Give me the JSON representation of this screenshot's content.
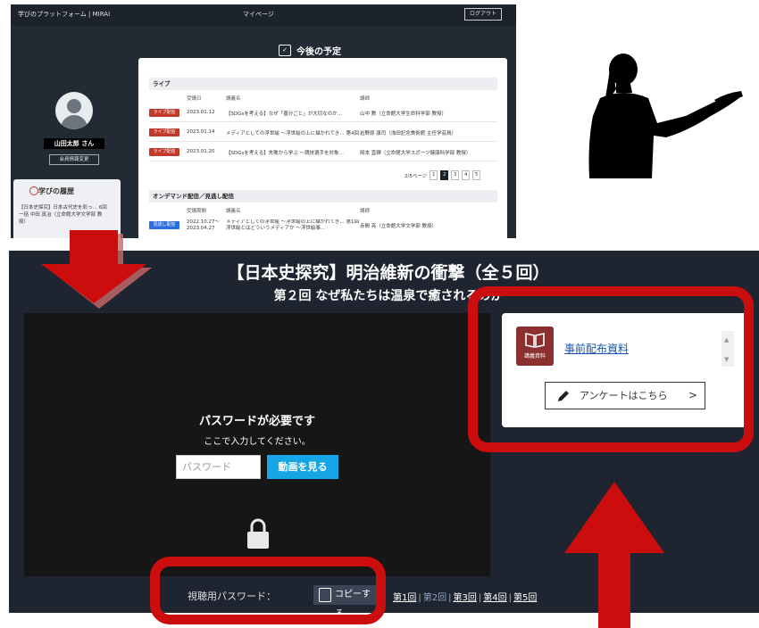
{
  "top_screenshot": {
    "brand": "学びのプラットフォーム | MIRAI",
    "page_title": "マイページ",
    "logout_label": "ログアウト",
    "schedule_heading": "今後の予定",
    "user_name": "山田太郎 さん",
    "profile_button": "会員情報変更",
    "history_heading": "学びの履歴",
    "history_item": "【日本史探究】日本古代史を彩っ… 6回一括 中田 真冶（立命館大学文学部 教授）",
    "live": {
      "section": "ライブ",
      "columns": [
        "受講日",
        "講義名",
        "講師"
      ],
      "rows": [
        {
          "tag": "ライブ配信",
          "date": "2023.01.12",
          "title": "【SDGsを考える】なぜ「善分ごと」が大切なのか…",
          "lecturer": "山中 教（立命館大学生命科学部 教授）"
        },
        {
          "tag": "ライブ配信",
          "date": "2023.01.14",
          "title": "メディアとしての浮世絵 ～浮世絵の上に描かれてき… 第4回 浮世絵は戦争をどう描いたか",
          "lecturer": "岩野原 康司（浅田記念美術館 主任学芸員）"
        },
        {
          "tag": "ライブ配信",
          "date": "2023.01.20",
          "title": "【SDGsを考える】失敗から学ぶ ～競技選手を対象…",
          "lecturer": "岡本 直輝（立命館大学スポーツ健康科学部 教授）"
        }
      ],
      "pager_text": "2/5ページ",
      "pages": [
        "1",
        "2",
        "3",
        "4",
        "5"
      ]
    },
    "ondemand": {
      "section": "オンデマンド配信／見逃し配信",
      "columns": [
        "受講期間",
        "講義名",
        "講師"
      ],
      "rows": [
        {
          "tag": "見逃し配信",
          "date": "2022.10.27～ 2023.04.27",
          "title": "メディアとしての浮世絵 ～浮世絵の上に描かれてき… 第1回 浮世絵とはどういうメディアか ～浮世絵事…",
          "lecturer": "赤間 亮（立命館大学文学部 教授）"
        }
      ]
    }
  },
  "bottom_screenshot": {
    "course_title": "【日本史探究】明治維新の衝撃（全５回）",
    "episode_title": "第２回 なぜ私たちは温泉で癒されるのか",
    "password_required": "パスワードが必要です",
    "password_instruction": "ここで入力してください。",
    "password_placeholder": "パスワード",
    "watch_button": "動画を見る",
    "viewing_password_label": "視聴用パスワード：",
    "copy_button": "コピーする",
    "episodes": [
      "第1回",
      "第2回",
      "第3回",
      "第4回",
      "第5回"
    ],
    "current_episode_index": 1,
    "resource_label": "講義資料",
    "resource_link": "事前配布資料",
    "survey_button": "アンケートはこちら",
    "survey_chevron": ">"
  },
  "colors": {
    "highlight_red": "#cc0d0d",
    "watch_button_blue": "#16a6e6",
    "book_icon_bg": "#8b2f2f",
    "dark_bg": "#1f2530"
  }
}
